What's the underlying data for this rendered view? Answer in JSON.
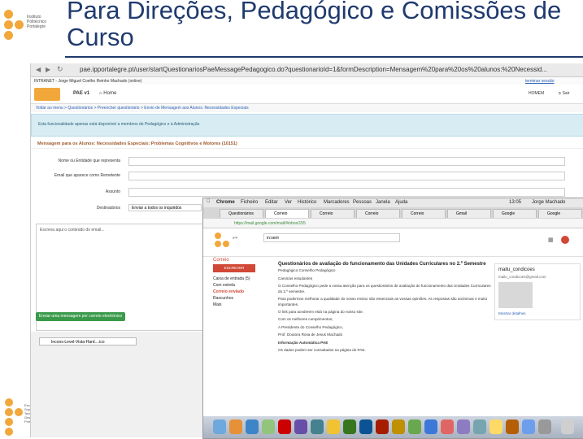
{
  "slide": {
    "title": "Para Direções, Pedagógico e Comissões de Curso",
    "logo_top": [
      "Instituto",
      "Politécnico",
      "Portalegre"
    ],
    "logo_bottom": [
      "Escola",
      "Superior",
      "Tecnologia",
      "Gestão",
      "Portalegre"
    ]
  },
  "browser": {
    "url": "pae.ipportalegre.pt/user/startQuestionariosPaeMessagePedagogico.do?questionarioId=1&formDescription=Mensagem%20para%20os%20alunos:%20Necessid...",
    "intranet": "INTRANET - Jorge Miguel Coelho Reinho Machado (online)",
    "session_link": "terminar sessão",
    "app_name": "PAE v1",
    "home": "Home",
    "user_name": "HOMEM",
    "logout": "Sair",
    "breadcrumb": "Voltar ao menu > Questionários > Preencher questionário > Envio de Mensagem aos Alunos: Necessidades Especiais",
    "info_message": "Esta funcionalidade apenas está disponível a membros do Pedagógico e à Administração",
    "form_title": "Mensagem para os Alunos: Necessidades Especiais: Problemas Cognitivos e Motores (10151)",
    "fields": [
      {
        "label": "Nome ou Entidade que representa",
        "value": ""
      },
      {
        "label": "Email que aparece como Remetente",
        "value": ""
      },
      {
        "label": "Assunto",
        "value": ""
      },
      {
        "label": "Destinatários",
        "value": "Enviar a todos os inquiridos"
      }
    ],
    "textarea_placeholder": "Escreva aqui o conteúdo do email...",
    "send_button": "Enviar uma mensagem por correio electrónico",
    "download_file": "Incons-Level-Vista-Hard....ico"
  },
  "gmail_window": {
    "menu": [
      "Chrome",
      "Ficheiro",
      "Editar",
      "Ver",
      "Histórico",
      "Marcadores",
      "Pessoas",
      "Janela",
      "Ajuda"
    ],
    "clock": "13:05",
    "user": "Jorge Machado",
    "tabs": [
      "Questionários",
      "Correio",
      "Correio",
      "Correio",
      "Correio",
      "Gmail",
      "Google",
      "Google"
    ],
    "address": "https://mail.google.com/mail/#inbox/155",
    "search_text": "in:sent",
    "logo_label": "Correio",
    "compose": "ESCREVER",
    "nav": [
      "Caixa de entrada (5)",
      "Com estrela",
      "Correio enviado",
      "Rascunhos",
      "Mais"
    ],
    "subject": "Questionários de avaliação do funcionamento das Unidades Curriculares no 2.º Semestre",
    "from_line": "Pedagógico Conselho Pedagógico",
    "body": [
      "Caros/as estudantes",
      "O Conselho Pedagógico pede a vossa atenção para os questionários de avaliação do funcionamento das Unidades Curriculares do 2.º semestre.",
      "Para podermos melhorar a qualidade do nosso ensino são essenciais as vossas opiniões. As respostas são anónimas e muito importantes.",
      "O link para acederem está na página do nosso site.",
      "Com os melhores cumprimentos,",
      "A Presidente do Conselho Pedagógico,",
      "Prof. Doutora Rosa de Jesus Machado",
      "Informação Automática PAE",
      "Os dados podem ser consultados na página do PAE."
    ],
    "contact_name": "mailu_condicoes",
    "contact_detail": "mailu_condicoes@gmail.com",
    "contact_action": "Mostrar detalhes"
  }
}
